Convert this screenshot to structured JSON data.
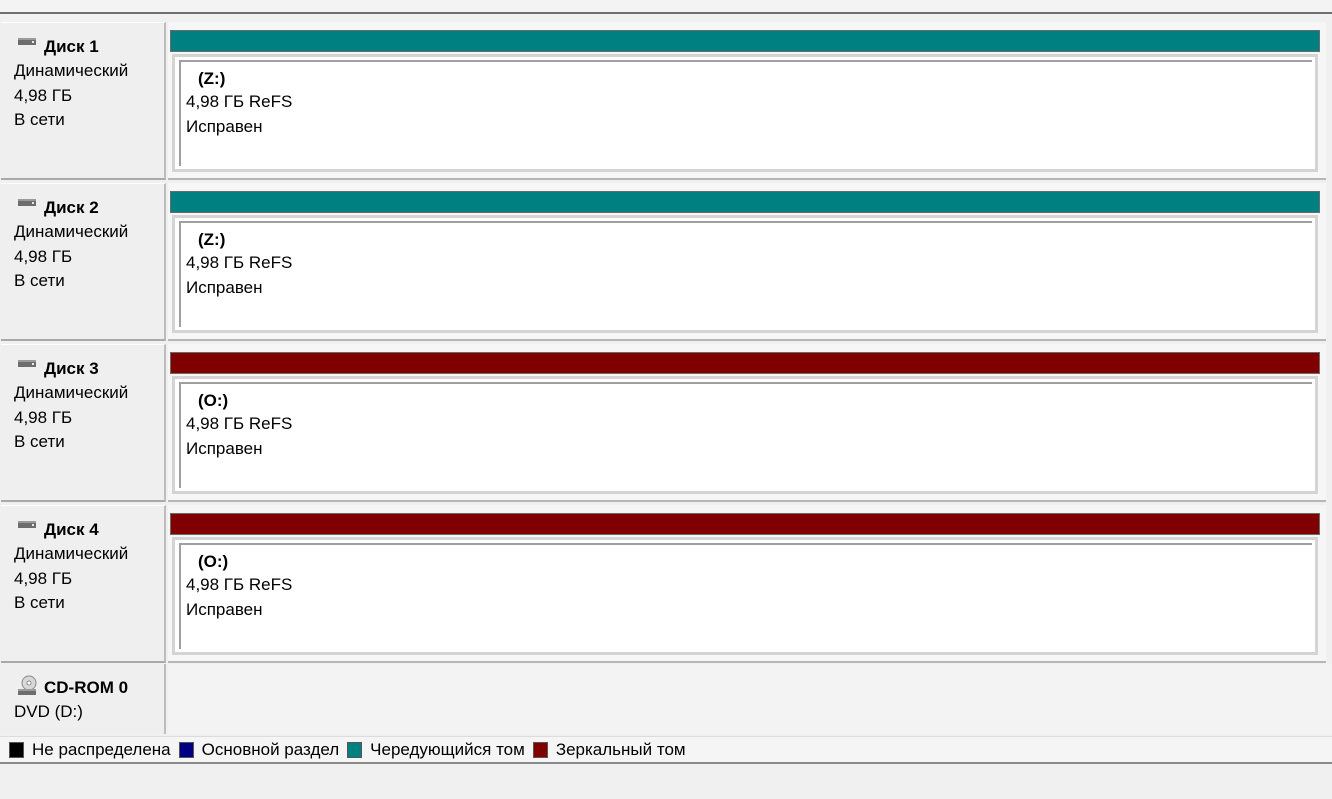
{
  "colors": {
    "unallocated": "#000000",
    "primary": "#000080",
    "striped": "#008080",
    "mirrored": "#800000"
  },
  "disks": [
    {
      "icon": "hard-disk-icon",
      "name": "Диск 1",
      "type": "Динамический",
      "size": "4,98 ГБ",
      "status": "В сети",
      "volume": {
        "label": "(Z:)",
        "details": "4,98 ГБ ReFS",
        "health": "Исправен",
        "kind": "striped",
        "color": "#008080"
      }
    },
    {
      "icon": "hard-disk-icon",
      "name": "Диск 2",
      "type": "Динамический",
      "size": "4,98 ГБ",
      "status": "В сети",
      "volume": {
        "label": "(Z:)",
        "details": "4,98 ГБ ReFS",
        "health": "Исправен",
        "kind": "striped",
        "color": "#008080"
      }
    },
    {
      "icon": "hard-disk-icon",
      "name": "Диск 3",
      "type": "Динамический",
      "size": "4,98 ГБ",
      "status": "В сети",
      "volume": {
        "label": "(O:)",
        "details": "4,98 ГБ ReFS",
        "health": "Исправен",
        "kind": "mirrored",
        "color": "#800000"
      }
    },
    {
      "icon": "hard-disk-icon",
      "name": "Диск 4",
      "type": "Динамический",
      "size": "4,98 ГБ",
      "status": "В сети",
      "volume": {
        "label": "(O:)",
        "details": "4,98 ГБ ReFS",
        "health": "Исправен",
        "kind": "mirrored",
        "color": "#800000"
      }
    }
  ],
  "cdrom": {
    "icon": "cd-rom-icon",
    "name": "CD-ROM 0",
    "drive": "DVD (D:)"
  },
  "legend": [
    {
      "label": "Не распределена",
      "color": "#000000"
    },
    {
      "label": "Основной раздел",
      "color": "#000080"
    },
    {
      "label": "Чередующийся том",
      "color": "#008080"
    },
    {
      "label": "Зеркальный том",
      "color": "#800000"
    }
  ]
}
